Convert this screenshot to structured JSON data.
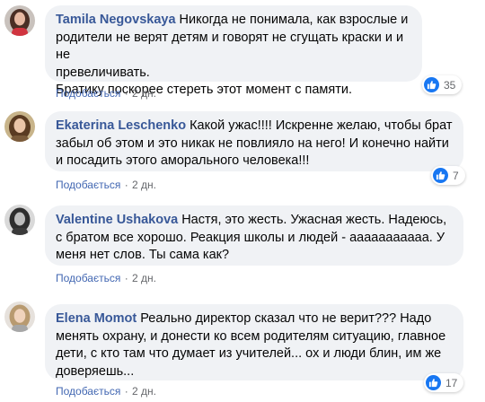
{
  "colors": {
    "link": "#385898",
    "like_link": "#4267b2",
    "bubble": "#f0f2f5",
    "like_badge": "#1877f2"
  },
  "comments": [
    {
      "author": "Tamila Negovskaya",
      "text": "Никогда не понимала, как взрослые и\nродители не верят детям и говорят не сгущать краски и и не\nпревеличивать.\nБратику поскорее стереть этот момент с памяти.",
      "like_label": "Подобається",
      "separator": "·",
      "time": "2 дн.",
      "reaction_icon": "thumbs-up-icon",
      "reaction_count": "35"
    },
    {
      "author": "Ekaterina Leschenko",
      "text": "Какой ужас!!!! Искренне желаю, чтобы брат\nзабыл об этом и это никак не повлияло на него! И конечно найти\nи посадить этого аморального человека!!!",
      "like_label": "Подобається",
      "separator": "·",
      "time": "2 дн.",
      "reaction_icon": "thumbs-up-icon",
      "reaction_count": "7"
    },
    {
      "author": "Valentine Ushakova",
      "text": "Настя, это жесть. Ужасная жесть. Надеюсь,\nс братом все хорошо. Реакция школы и людей - ааааааааааа. У\nменя нет слов. Ты сама как?",
      "like_label": "Подобається",
      "separator": "·",
      "time": "2 дн."
    },
    {
      "author": "Elena Momot",
      "text": "Реально директор сказал что не верит??? Надо\nменять охрану, и донести ко всем родителям ситуацию, главное\nдети, с кто там что думает из учителей... ох и люди блин, им же\nдоверяешь...",
      "like_label": "Подобається",
      "separator": "·",
      "time": "2 дн.",
      "reaction_icon": "thumbs-up-icon",
      "reaction_count": "17"
    }
  ]
}
